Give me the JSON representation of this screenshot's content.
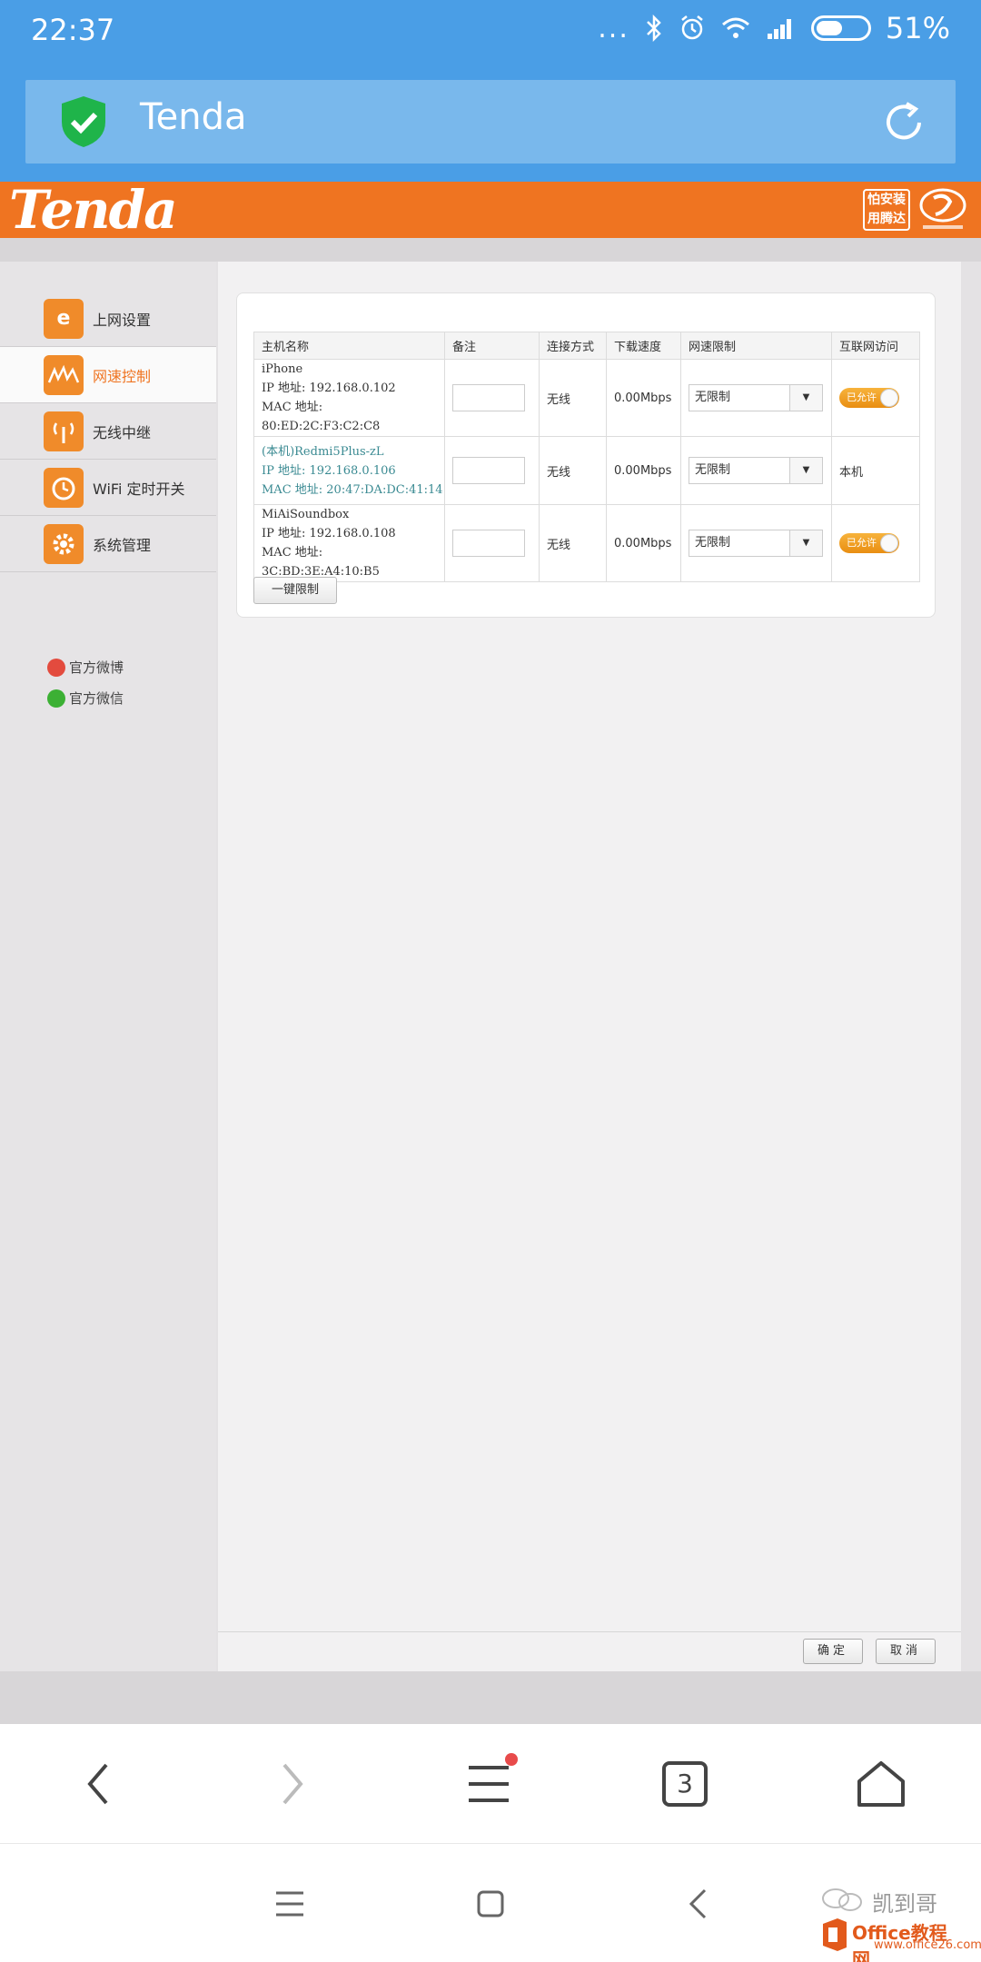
{
  "status_bar": {
    "time": "22:37",
    "dots": "...",
    "battery_percent": "51%",
    "battery_level": 0.51
  },
  "browser": {
    "page_title": "Tenda",
    "tab_count": "3"
  },
  "header": {
    "logo": "Tenda",
    "badge_line1": "怕安装",
    "badge_line2": "用腾达"
  },
  "sidebar": {
    "items": [
      {
        "label": "上网设置",
        "icon": "e-icon"
      },
      {
        "label": "网速控制",
        "icon": "speed-wave-icon"
      },
      {
        "label": "无线中继",
        "icon": "antenna-icon"
      },
      {
        "label": "WiFi 定时开关",
        "icon": "timer-icon"
      },
      {
        "label": "系统管理",
        "icon": "gear-icon"
      }
    ],
    "social": [
      {
        "label": "官方微博",
        "icon": "weibo-icon"
      },
      {
        "label": "官方微信",
        "icon": "wechat-icon"
      }
    ]
  },
  "table": {
    "headers": [
      "主机名称",
      "备注",
      "连接方式",
      "下载速度",
      "网速限制",
      "互联网访问"
    ],
    "rows": [
      {
        "name": "iPhone",
        "ip": "IP 地址: 192.168.0.102",
        "mac": "MAC 地址: 80:ED:2C:F3:C2:C8",
        "conn": "无线",
        "speed": "0.00Mbps",
        "limit": "无限制",
        "access": "已允许"
      },
      {
        "name": "(本机)Redmi5Plus-zL",
        "ip": "IP 地址: 192.168.0.106",
        "mac": "MAC 地址: 20:47:DA:DC:41:14",
        "conn": "无线",
        "speed": "0.00Mbps",
        "limit": "无限制",
        "access": "本机"
      },
      {
        "name": "MiAiSoundbox",
        "ip": "IP 地址: 192.168.0.108",
        "mac": "MAC 地址: 3C:BD:3E:A4:10:B5",
        "conn": "无线",
        "speed": "0.00Mbps",
        "limit": "无限制",
        "access": "已允许"
      }
    ]
  },
  "buttons": {
    "limit_all": "一键限制",
    "confirm": "确定",
    "cancel": "取消"
  },
  "watermark": {
    "name": "凯到哥",
    "site": "Office教程网",
    "url": "www.office26.com"
  },
  "colors": {
    "brand_orange": "#ef7421",
    "browser_blue": "#4a9ee6"
  }
}
